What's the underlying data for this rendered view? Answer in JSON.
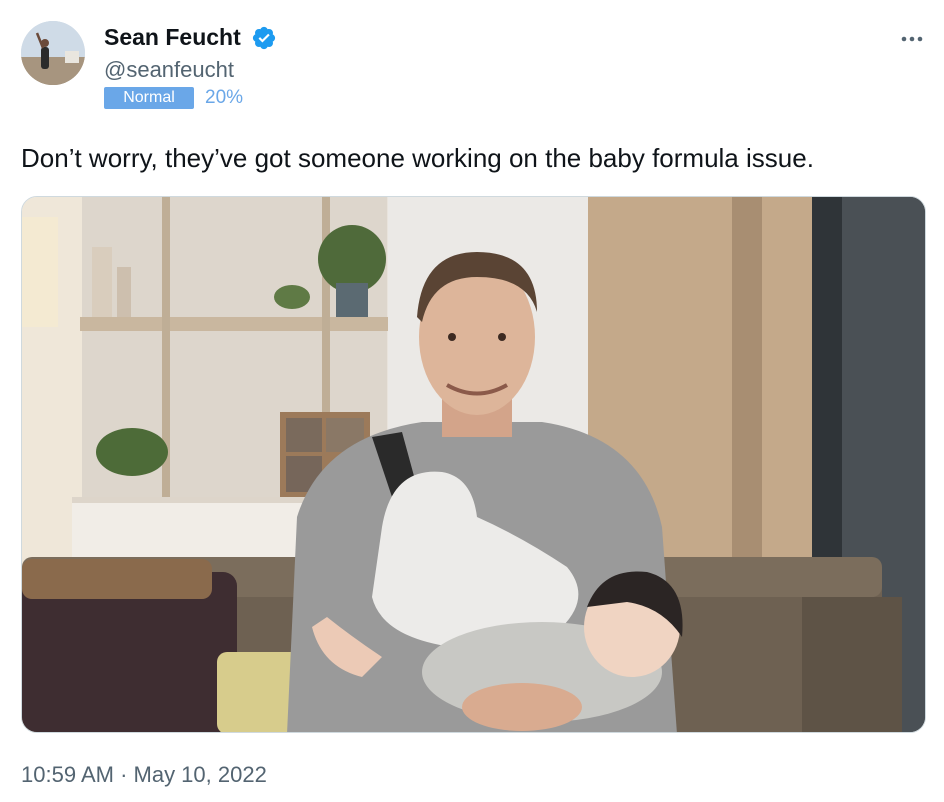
{
  "author": {
    "name": "Sean Feucht",
    "handle": "@seanfeucht",
    "verified": true
  },
  "reading_mode": {
    "label": "Normal",
    "percent": "20%"
  },
  "tweet": {
    "text": "Don’t worry, they’ve got someone working on the baby formula issue.",
    "timestamp": "10:59 AM · May 10, 2022"
  },
  "icons": {
    "verified": "verified-badge-icon",
    "more": "more-options-icon"
  },
  "colors": {
    "verified_blue": "#1d9bf0",
    "badge_blue": "#6aa7e8",
    "secondary_text": "#536471",
    "primary_text": "#0f1419"
  }
}
